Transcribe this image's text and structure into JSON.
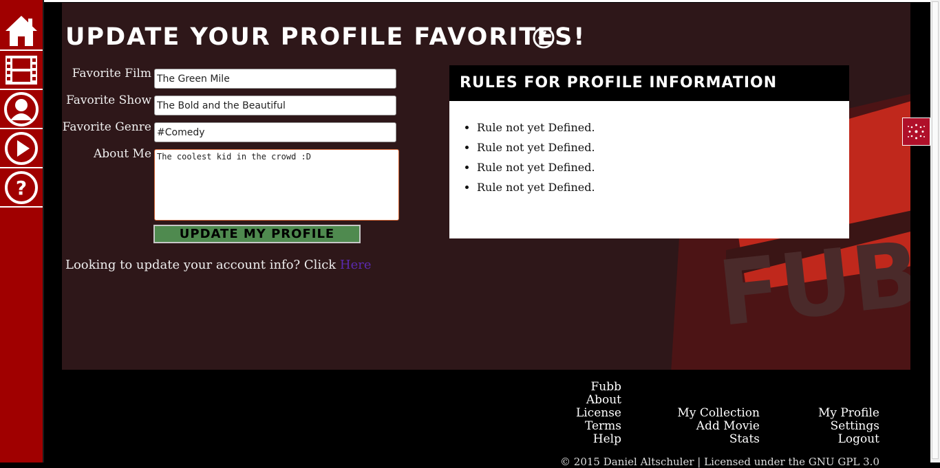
{
  "page": {
    "title": "Update Your Profile Favorites!"
  },
  "nav": [
    {
      "name": "home",
      "icon": "home-icon"
    },
    {
      "name": "movies",
      "icon": "film-icon"
    },
    {
      "name": "profile",
      "icon": "user-icon"
    },
    {
      "name": "play",
      "icon": "play-icon"
    },
    {
      "name": "help",
      "icon": "help-icon"
    }
  ],
  "form": {
    "film_label": "Favorite Film",
    "film_value": "The Green Mile",
    "show_label": "Favorite Show",
    "show_value": "The Bold and the Beautiful",
    "genre_label": "Favorite Genre",
    "genre_value": "#Comedy",
    "about_label": "About Me",
    "about_value": "The coolest kid in the crowd :D",
    "submit_label": "Update My Profile",
    "account_text": "Looking to update your account info? Click ",
    "account_link": "Here"
  },
  "rules": {
    "header": "Rules for Profile Information",
    "items": [
      "Rule not yet Defined.",
      "Rule not yet Defined.",
      "Rule not yet Defined.",
      "Rule not yet Defined."
    ]
  },
  "footer": {
    "col1": [
      "Fubb",
      "About",
      "License",
      "Terms",
      "Help"
    ],
    "col2": [
      "My Collection",
      "Add Movie",
      "Stats"
    ],
    "col3": [
      "My Profile",
      "Settings",
      "Logout"
    ],
    "copyright": "© 2015 Daniel Altschuler | Licensed under the GNU GPL 3.0"
  },
  "background_logo_text": "FUBB",
  "colors": {
    "sidebar": "#a00000",
    "panel": "#2e1719",
    "button": "#4f8a4f",
    "link": "#5b2ab0"
  }
}
